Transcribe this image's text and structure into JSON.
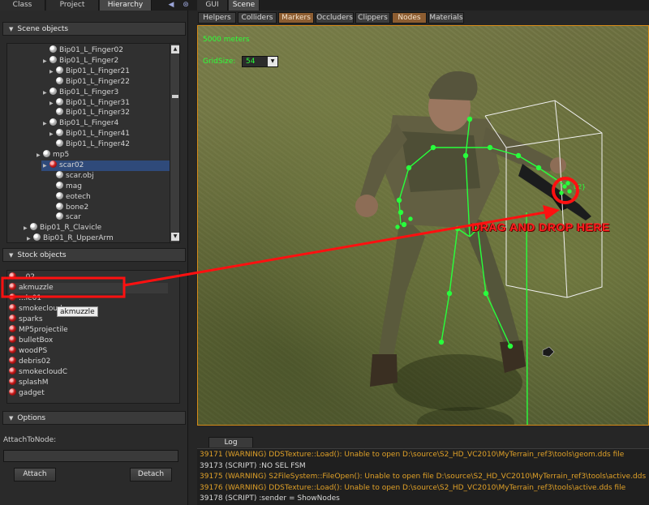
{
  "tabs": {
    "items": [
      {
        "label": "Class",
        "active": false
      },
      {
        "label": "Project",
        "active": false
      },
      {
        "label": "Hierarchy",
        "active": true
      }
    ],
    "right": [
      {
        "label": "GUI",
        "active": false
      },
      {
        "label": "Scene",
        "active": true
      }
    ]
  },
  "scene_objects": {
    "title": "Scene objects",
    "rows": [
      {
        "label": "Bip01_L_Finger02",
        "icon": "node-sphere-icon"
      },
      {
        "label": "Bip01_L_Finger2",
        "icon": "node-sphere-icon"
      },
      {
        "label": "Bip01_L_Finger21",
        "icon": "node-sphere-icon"
      },
      {
        "label": "Bip01_L_Finger22",
        "icon": "node-sphere-icon"
      },
      {
        "label": "Bip01_L_Finger3",
        "icon": "node-sphere-icon"
      },
      {
        "label": "Bip01_L_Finger31",
        "icon": "node-sphere-icon"
      },
      {
        "label": "Bip01_L_Finger32",
        "icon": "node-sphere-icon"
      },
      {
        "label": "Bip01_L_Finger4",
        "icon": "node-sphere-icon"
      },
      {
        "label": "Bip01_L_Finger41",
        "icon": "node-sphere-icon"
      },
      {
        "label": "Bip01_L_Finger42",
        "icon": "node-sphere-icon"
      },
      {
        "label": "mp5",
        "icon": "node-sphere-icon"
      },
      {
        "label": "scar02",
        "icon": "object-red-sphere-icon",
        "selected": true
      },
      {
        "label": "scar.obj",
        "icon": "node-sphere-icon"
      },
      {
        "label": "mag",
        "icon": "node-sphere-icon"
      },
      {
        "label": "eotech",
        "icon": "node-sphere-icon"
      },
      {
        "label": "bone2",
        "icon": "node-sphere-icon"
      },
      {
        "label": "scar",
        "icon": "node-sphere-icon"
      },
      {
        "label": "Bip01_R_Clavicle",
        "icon": "node-sphere-icon"
      },
      {
        "label": "Bip01_R_UpperArm",
        "icon": "node-sphere-icon"
      }
    ]
  },
  "stock_objects": {
    "title": "Stock objects",
    "rows": [
      {
        "label": "...02"
      },
      {
        "label": "akmuzzle",
        "selected": true
      },
      {
        "label": "...le01"
      },
      {
        "label": "smokecloud"
      },
      {
        "label": "sparks"
      },
      {
        "label": "MP5projectile"
      },
      {
        "label": "bulletBox"
      },
      {
        "label": "woodPS"
      },
      {
        "label": "debris02"
      },
      {
        "label": "smokecloudC"
      },
      {
        "label": "splashM"
      },
      {
        "label": "gadget"
      }
    ],
    "tooltip": "akmuzzle"
  },
  "options": {
    "title": "Options",
    "attach_label": "AttachToNode:",
    "attach_value": "",
    "attach_button": "Attach",
    "detach_button": "Detach"
  },
  "scene_toolbar": [
    {
      "label": "Helpers",
      "accent": false
    },
    {
      "label": "Colliders",
      "accent": false
    },
    {
      "label": "Markers",
      "accent": true
    },
    {
      "label": "Occluders",
      "accent": false
    },
    {
      "label": "Clippers",
      "accent": false
    },
    {
      "label": "Nodes",
      "accent": true
    },
    {
      "label": "Materials",
      "accent": false
    }
  ],
  "viewport": {
    "distance": "5000 meters",
    "grid_label": "GridSize:",
    "grid_value": "54",
    "hint": "DRAG AND DROP HERE",
    "node_tag": "02}",
    "accent_color": "#d68a18",
    "annotation_color": "#ff1010"
  },
  "log": {
    "tab": "Log",
    "lines": [
      {
        "text": "39171 (WARNING) DDSTexture::Load(): Unable to open D:\\source\\S2_HD_VC2010\\MyTerrain_ref3\\tools\\geom.dds file",
        "level": "warn"
      },
      {
        "text": "39173 (SCRIPT) :NO SEL FSM",
        "level": "info"
      },
      {
        "text": "39175 (WARNING) S2FileSystem::FileOpen(): Unable to open file D:\\source\\S2_HD_VC2010\\MyTerrain_ref3\\tools\\active.dds",
        "level": "warn"
      },
      {
        "text": "39176 (WARNING) DDSTexture::Load(): Unable to open D:\\source\\S2_HD_VC2010\\MyTerrain_ref3\\tools\\active.dds file",
        "level": "warn"
      },
      {
        "text": "39178 (SCRIPT) :sender = ShowNodes",
        "level": "info"
      }
    ]
  }
}
